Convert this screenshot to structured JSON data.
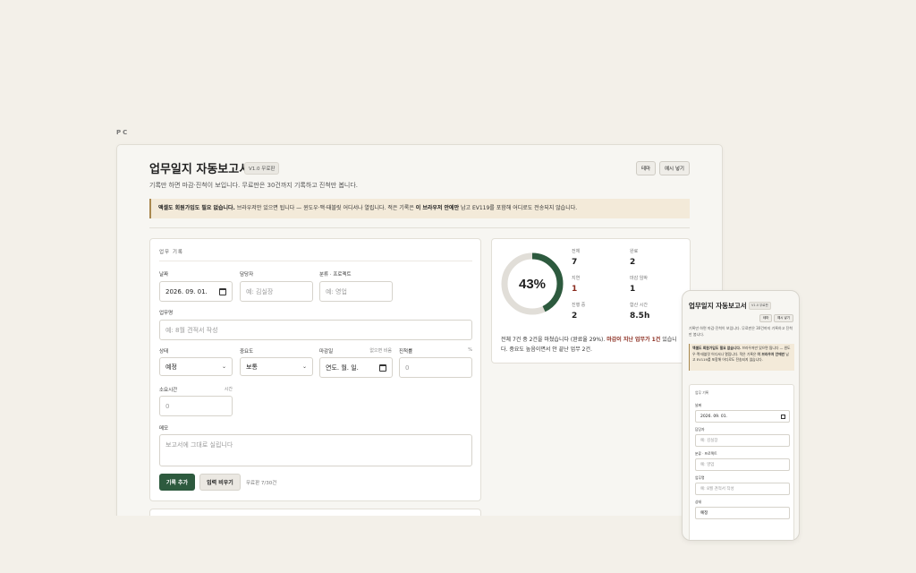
{
  "page_label": "PC",
  "app": {
    "title": "업무일지 자동보고서",
    "version": "V1.0 무료판",
    "subtitle": "기록만 하면 마감·진척이 보입니다. 무료판은 30건까지 기록하고 진척만 봅니다.",
    "theme_button": "테마",
    "sample_button": "예시 넣기",
    "notice_bold": "액셀도 회원가입도 필요 없습니다.",
    "notice_text": " 브라우저만 있으면 됩니다 — 윈도우·맥·태블릿 어디서나 열립니다. 적은 기록은 ",
    "notice_bold2": "이 브라우저 안에만",
    "notice_text2": " 남고 EV119를 포함해 어디로도 전송되지 않습니다."
  },
  "form": {
    "card_title": "업무 기록",
    "date_label": "날짜",
    "date_value": "2026. 09. 01.",
    "owner_label": "담당자",
    "owner_placeholder": "예: 김실장",
    "category_label": "분류 · 프로젝트",
    "category_placeholder": "예: 영업",
    "task_label": "업무명",
    "task_placeholder": "예: 8월 견적서 작성",
    "status_label": "상태",
    "status_value": "예정",
    "priority_label": "중요도",
    "priority_value": "보통",
    "due_label": "마감일",
    "due_hint": "없으면 비움",
    "due_placeholder": "연도. 월. 일.",
    "progress_label": "진척률",
    "progress_unit": "%",
    "progress_placeholder": "0",
    "hours_label": "소요시간",
    "hours_unit": "시간",
    "hours_placeholder": "0",
    "memo_label": "메모",
    "memo_placeholder": "보고서에 그대로 실립니다",
    "add_button": "기록 추가",
    "clear_button": "입력 비우기",
    "quota": "무료판 7/30건"
  },
  "stats": {
    "percent_text": "43%",
    "percent": 43,
    "ring_color": "#2d5a3e",
    "items": [
      {
        "label": "전체",
        "value": "7"
      },
      {
        "label": "완료",
        "value": "2"
      },
      {
        "label": "지연",
        "value": "1"
      },
      {
        "label": "마감 임박",
        "value": "1"
      },
      {
        "label": "진행 중",
        "value": "2"
      },
      {
        "label": "합산 시간",
        "value": "8.5h"
      }
    ],
    "summary_a": "전체 7건 중 2건을 마쳤습니다 (완료율 29%). ",
    "summary_warn": "마감이 지난 업무가 1건",
    "summary_b": " 있습니다. 중요도 높음이면서 안 끝난 업무 2건."
  },
  "mobile": {
    "title": "업무일지 자동보고서",
    "version": "V1.0 무료판",
    "theme_button": "테마",
    "sample_button": "예시 넣기",
    "subtitle": "기록만 하면 마감·진척이 보입니다. 무료판은 30건까지 기록하고 진척만 봅니다.",
    "notice_bold": "액셀도 회원가입도 필요 없습니다.",
    "notice_text": " 브라우저만 있으면 됩니다 — 윈도우·맥·태블릿 어디서나 열립니다. 적은 기록은 ",
    "notice_bold2": "이 브라우저 안에만",
    "notice_text2": " 남고 EV119를 포함해 어디로도 전송되지 않습니다.",
    "card_title": "업무 기록",
    "date_label": "날짜",
    "date_value": "2026. 09. 01.",
    "owner_label": "담당자",
    "owner_placeholder": "예: 김실장",
    "category_label": "분류 · 프로젝트",
    "category_placeholder": "예: 영업",
    "task_label": "업무명",
    "task_placeholder": "예: 8월 견적서 작성",
    "status_label": "상태",
    "status_value": "예정"
  }
}
